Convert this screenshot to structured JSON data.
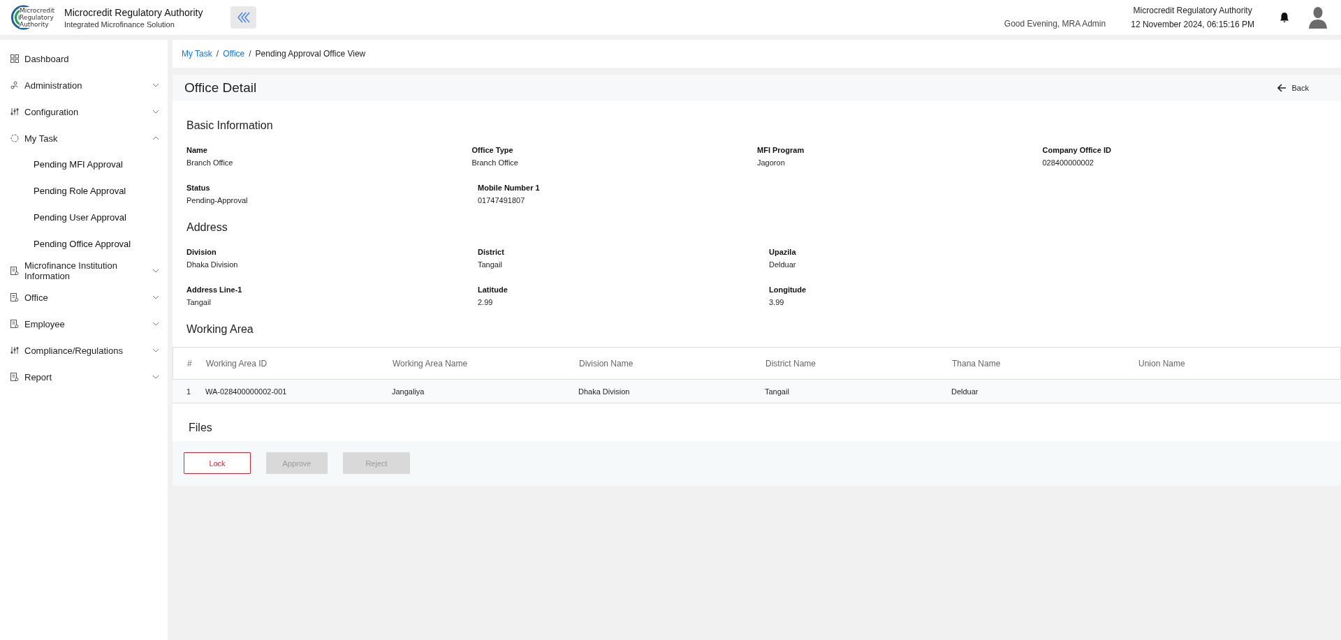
{
  "header": {
    "logo_text": "Microcredit Regulatory Authority",
    "title": "Microcredit Regulatory Authority",
    "subtitle": "Integrated Microfinance Solution",
    "greeting": "Good Evening, MRA Admin",
    "org_name": "Microcredit Regulatory Authority",
    "datetime": "12 November 2024, 06:15:16 PM"
  },
  "sidebar": {
    "items": [
      {
        "label": "Dashboard",
        "kind": "link"
      },
      {
        "label": "Administration",
        "kind": "group",
        "expanded": false
      },
      {
        "label": "Configuration",
        "kind": "group",
        "expanded": false
      },
      {
        "label": "My Task",
        "kind": "group",
        "expanded": true,
        "children": [
          {
            "label": "Pending MFI Approval"
          },
          {
            "label": "Pending Role Approval"
          },
          {
            "label": "Pending User Approval"
          },
          {
            "label": "Pending Office Approval"
          }
        ]
      },
      {
        "label": "Microfinance Institution Information",
        "kind": "group",
        "expanded": false
      },
      {
        "label": "Office",
        "kind": "group",
        "expanded": false
      },
      {
        "label": "Employee",
        "kind": "group",
        "expanded": false
      },
      {
        "label": "Compliance/Regulations",
        "kind": "group",
        "expanded": false
      },
      {
        "label": "Report",
        "kind": "group",
        "expanded": false
      }
    ]
  },
  "breadcrumb": [
    {
      "label": "My Task",
      "kind": "link"
    },
    {
      "label": "/",
      "kind": "separator"
    },
    {
      "label": "Office",
      "kind": "link"
    },
    {
      "label": "/",
      "kind": "separator"
    },
    {
      "label": "Pending Approval Office View",
      "kind": "current"
    }
  ],
  "page": {
    "title": "Office Detail",
    "back": "Back"
  },
  "basic_information": {
    "title": "Basic Information",
    "rows": [
      [
        {
          "label": "Name",
          "value": "Branch Office"
        },
        {
          "label": "Office Type",
          "value": "Branch Office"
        },
        {
          "label": "MFI Program",
          "value": "Jagoron"
        },
        {
          "label": "Company Office ID",
          "value": "028400000002"
        }
      ],
      [
        {
          "label": "Status",
          "value": "Pending-Approval"
        },
        {
          "label": "Mobile Number 1",
          "value": "01747491807"
        }
      ]
    ]
  },
  "address": {
    "title": "Address",
    "rows": [
      [
        {
          "label": "Division",
          "value": "Dhaka Division"
        },
        {
          "label": "District",
          "value": "Tangail"
        },
        {
          "label": "Upazila",
          "value": "Delduar"
        }
      ],
      [
        {
          "label": "Address Line-1",
          "value": "Tangail"
        },
        {
          "label": "Latitude",
          "value": "2.99"
        },
        {
          "label": "Longitude",
          "value": "3.99"
        }
      ]
    ]
  },
  "working_area": {
    "title": "Working Area",
    "columns": [
      "#",
      "Working Area ID",
      "Working Area Name",
      "Division Name",
      "District Name",
      "Thana Name",
      "Union Name"
    ],
    "rows": [
      [
        "1",
        "WA-028400000002-001",
        "Jangaliya",
        "Dhaka Division",
        "Tangail",
        "Delduar"
      ]
    ]
  },
  "files": {
    "title": "Files"
  },
  "buttons": [
    {
      "label": "Lock",
      "kind": "danger",
      "disabled": false
    },
    {
      "label": "Approve",
      "kind": "primary",
      "disabled": true
    },
    {
      "label": "Reject",
      "kind": "secondary",
      "disabled": true
    }
  ]
}
